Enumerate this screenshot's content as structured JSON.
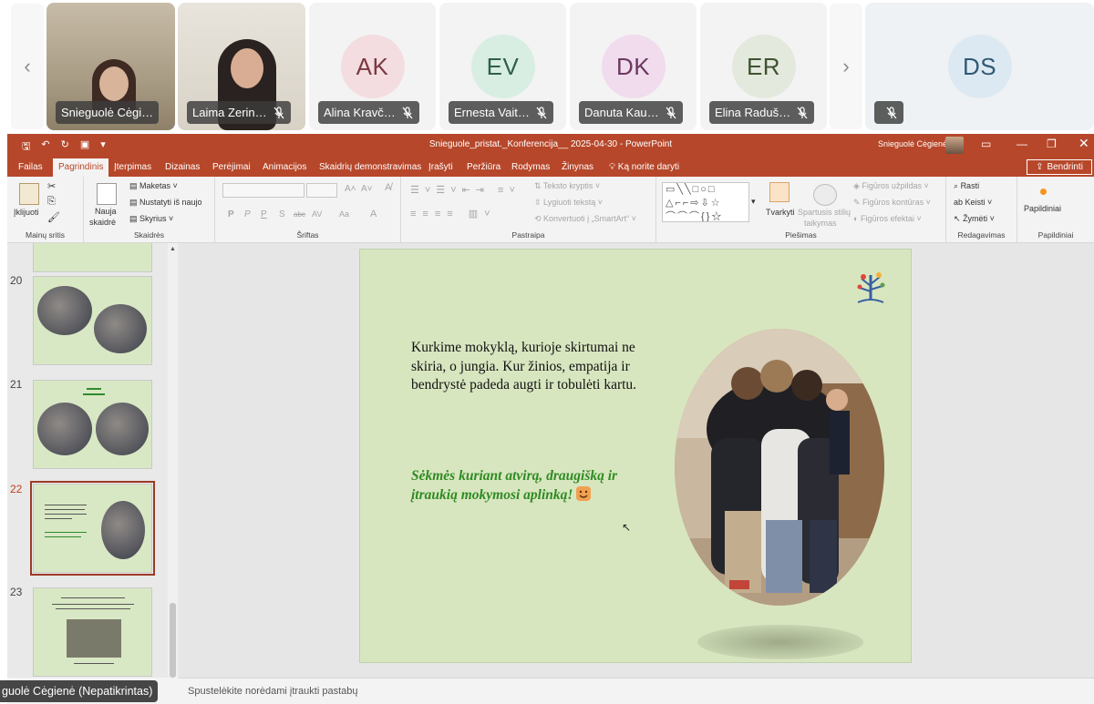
{
  "participants": [
    {
      "name": "Snieguolė Cėgi…",
      "type": "video",
      "muted": false
    },
    {
      "name": "Laima Zerin…",
      "type": "video",
      "muted": true
    },
    {
      "name": "Alina Kravč…",
      "initials": "AK",
      "muted": true,
      "bg": "#f4dde0",
      "fg": "#7a3a40"
    },
    {
      "name": "Ernesta Vait…",
      "initials": "EV",
      "muted": true,
      "bg": "#d8eee2",
      "fg": "#2f6048"
    },
    {
      "name": "Danuta Kau…",
      "initials": "DK",
      "muted": true,
      "bg": "#f0dcec",
      "fg": "#6c3763"
    },
    {
      "name": "Elina Raduš…",
      "initials": "ER",
      "muted": true,
      "bg": "#e3e9dc",
      "fg": "#3e5331"
    },
    {
      "name": "",
      "initials": "DS",
      "muted": true,
      "bg": "#dde9f2",
      "fg": "#2f5974"
    }
  ],
  "strip_nav": {
    "prev": "‹",
    "next": "›"
  },
  "window": {
    "title": "Snieguole_pristat._Konferencija__ 2025-04-30  -  PowerPoint",
    "user": "Snieguolė Cėgienė",
    "accent": "#b7472a"
  },
  "tabs": [
    "Failas",
    "Pagrindinis",
    "Įterpimas",
    "Dizainas",
    "Perėjimai",
    "Animacijos",
    "Skaidrių demonstravimas",
    "Įrašyti",
    "Peržiūra",
    "Rodymas",
    "Žinynas"
  ],
  "active_tab": "Pagrindinis",
  "tell_me": "Ką norite daryti",
  "share_label": "Bendrinti",
  "ribbon": {
    "paste": "Įklijuoti",
    "clipboard_label": "Mainų sritis",
    "new_slide_1": "Nauja",
    "new_slide_2": "skaidrė",
    "layout": "Maketas",
    "reset": "Nustatyti iš naujo",
    "section": "Skyrius",
    "slides_label": "Skaidrės",
    "font_label": "Šriftas",
    "text_direction": "Teksto kryptis",
    "align_text": "Lygiuoti tekstą",
    "convert_smartart": "Konvertuoti į „SmartArt“",
    "paragraph_label": "Pastraipa",
    "arrange": "Tvarkyti",
    "quick_styles_1": "Spartusis stilių",
    "quick_styles_2": "taikymas",
    "shape_fill": "Figūros užpildas",
    "shape_outline": "Figūros kontūras",
    "shape_effects": "Figūros efektai",
    "drawing_label": "Piešimas",
    "find": "Rasti",
    "replace": "Keisti",
    "select": "Žymėti",
    "editing_label": "Redagavimas",
    "addins": "Papildiniai",
    "addins_label": "Papildiniai",
    "font_buttons": [
      "P",
      "P",
      "P",
      "S",
      "abc",
      "AV",
      "Aa",
      "A"
    ]
  },
  "slides": [
    {
      "number": "20"
    },
    {
      "number": "21"
    },
    {
      "number": "22",
      "active": true
    },
    {
      "number": "23"
    }
  ],
  "slide": {
    "body": "Kurkime mokyklą, kurioje skirtumai ne skiria, o jungia. Kur žinios, empatija ir bendrystė padeda augti ir tobulėti kartu.",
    "closing": "Sėkmės kuriant atvirą, draugišką ir įtraukią mokymosi aplinką!",
    "bg": "#d8e6c0",
    "green": "#2e8b22"
  },
  "notes_placeholder": "Spustelėkite norėdami įtraukti pastabų",
  "caption": "guolė Cėgienė (Nepatikrintas)"
}
